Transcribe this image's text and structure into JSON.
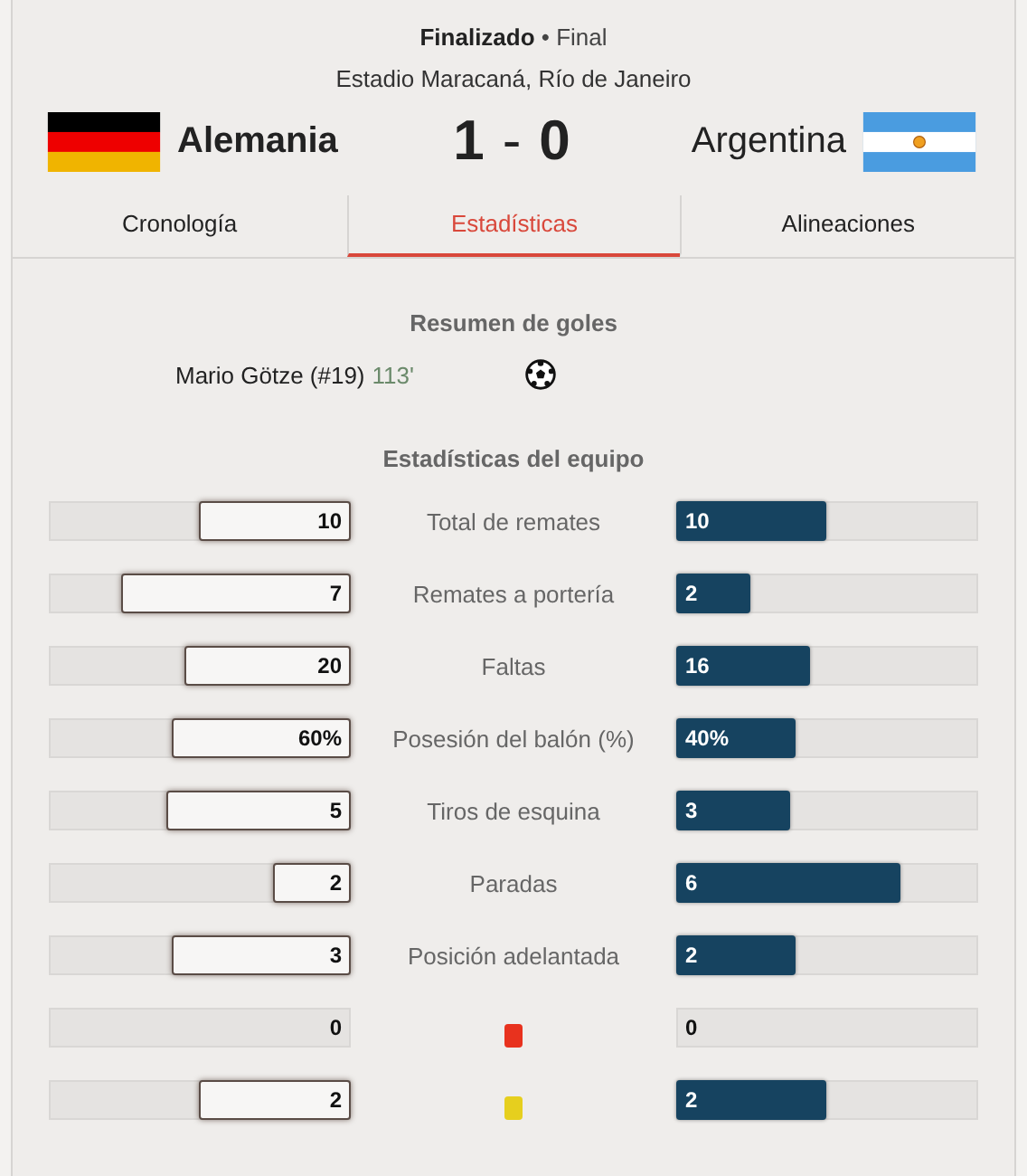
{
  "header": {
    "status": "**Finalizado** • Final",
    "venue": "Estadio Maracaná, Río de Janeiro"
  },
  "home": {
    "name": "Alemania",
    "score": "1"
  },
  "separator": "-",
  "away": {
    "name": "Argentina",
    "score": "0"
  },
  "tabs": [
    {
      "label": "Cronología",
      "selected": false
    },
    {
      "label": "Estadísticas",
      "selected": true
    },
    {
      "label": "Alineaciones",
      "selected": false
    }
  ],
  "goals_title": "Resumen de goles",
  "goals": [
    {
      "scorer": "Mario Götze (#19)",
      "minute": "113'"
    }
  ],
  "stats_title": "Estadísticas del equipo",
  "stats": [
    {
      "kind": "label",
      "label": "Total de remates",
      "home": {
        "value": "10",
        "level": 0.51
      },
      "away": {
        "value": "10",
        "level": 0.5
      }
    },
    {
      "kind": "label",
      "label": "Remates a portería",
      "home": {
        "value": "7",
        "level": 0.77
      },
      "away": {
        "value": "2",
        "level": 0.25
      }
    },
    {
      "kind": "label",
      "label": "Faltas",
      "home": {
        "value": "20",
        "level": 0.56
      },
      "away": {
        "value": "16",
        "level": 0.45
      }
    },
    {
      "kind": "label",
      "label": "Posesión del balón (%)",
      "home": {
        "value": "60%",
        "level": 0.6
      },
      "away": {
        "value": "40%",
        "level": 0.4
      }
    },
    {
      "kind": "label",
      "label": "Tiros de esquina",
      "home": {
        "value": "5",
        "level": 0.62
      },
      "away": {
        "value": "3",
        "level": 0.38
      }
    },
    {
      "kind": "label",
      "label": "Paradas",
      "home": {
        "value": "2",
        "level": 0.26
      },
      "away": {
        "value": "6",
        "level": 0.75
      }
    },
    {
      "kind": "label",
      "label": "Posición adelantada",
      "home": {
        "value": "3",
        "level": 0.6
      },
      "away": {
        "value": "2",
        "level": 0.4
      }
    },
    {
      "kind": "card",
      "color": "#e8321e",
      "home": {
        "value": "0"
      },
      "away": {
        "value": "0"
      }
    },
    {
      "kind": "card",
      "color": "#e6cf1e",
      "home": {
        "value": "2",
        "level": 0.51
      },
      "away": {
        "value": "2",
        "level": 0.5
      }
    }
  ]
}
